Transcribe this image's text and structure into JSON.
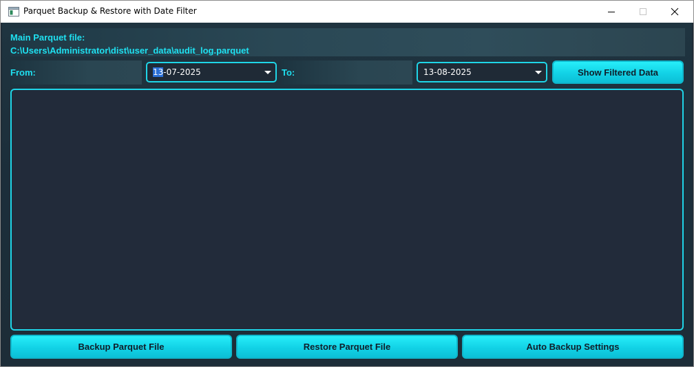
{
  "window": {
    "title": "Parquet Backup & Restore with Date Filter",
    "controls": {
      "minimize": "minimize-icon",
      "maximize": "maximize-icon",
      "close": "close-icon"
    }
  },
  "file": {
    "label": "Main Parquet file:",
    "path": "C:\\Users\\Administrator\\dist\\user_data\\audit_log.parquet"
  },
  "filter": {
    "from_label": "From:",
    "from_date_selected": "13",
    "from_date_rest": "-07-2025",
    "to_label": "To:",
    "to_date": "13-08-2025",
    "show_button": "Show Filtered Data"
  },
  "actions": {
    "backup": "Backup Parquet File",
    "restore": "Restore Parquet File",
    "auto_backup": "Auto Backup Settings"
  },
  "colors": {
    "accent": "#1fe0f0",
    "background": "#1d2b36",
    "panel": "#222b3a",
    "button": "#12d2e6"
  }
}
